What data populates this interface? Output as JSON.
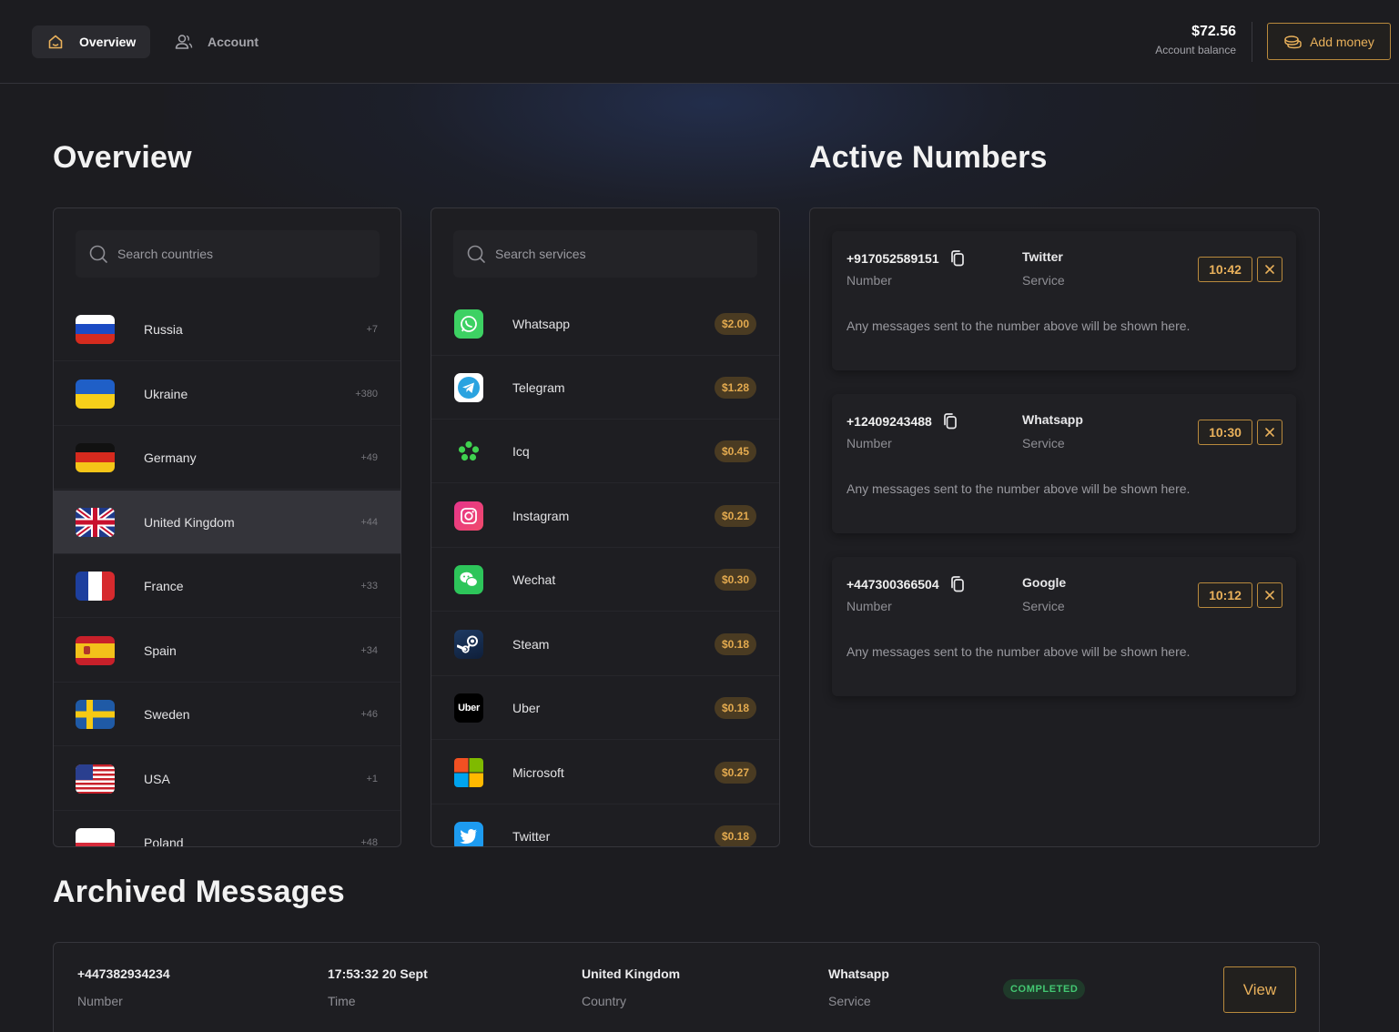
{
  "nav": {
    "tabs": [
      {
        "label": "Overview",
        "icon": "home-icon",
        "active": true
      },
      {
        "label": "Account",
        "icon": "users-icon",
        "active": false
      }
    ],
    "balance": {
      "amount": "$72.56",
      "label": "Account balance"
    },
    "add_money_label": "Add money"
  },
  "overview": {
    "title": "Overview",
    "countries": {
      "search_placeholder": "Search countries",
      "items": [
        {
          "name": "Russia",
          "code": "+7"
        },
        {
          "name": "Ukraine",
          "code": "+380"
        },
        {
          "name": "Germany",
          "code": "+49"
        },
        {
          "name": "United Kingdom",
          "code": "+44",
          "selected": true
        },
        {
          "name": "France",
          "code": "+33"
        },
        {
          "name": "Spain",
          "code": "+34"
        },
        {
          "name": "Sweden",
          "code": "+46"
        },
        {
          "name": "USA",
          "code": "+1"
        },
        {
          "name": "Poland",
          "code": "+48"
        }
      ]
    },
    "services": {
      "search_placeholder": "Search services",
      "items": [
        {
          "name": "Whatsapp",
          "price": "$2.00",
          "icon": "whatsapp-icon"
        },
        {
          "name": "Telegram",
          "price": "$1.28",
          "icon": "telegram-icon"
        },
        {
          "name": "Icq",
          "price": "$0.45",
          "icon": "icq-icon"
        },
        {
          "name": "Instagram",
          "price": "$0.21",
          "icon": "instagram-icon"
        },
        {
          "name": "Wechat",
          "price": "$0.30",
          "icon": "wechat-icon"
        },
        {
          "name": "Steam",
          "price": "$0.18",
          "icon": "steam-icon"
        },
        {
          "name": "Uber",
          "price": "$0.18",
          "icon": "uber-icon",
          "icon_text": "Uber"
        },
        {
          "name": "Microsoft",
          "price": "$0.27",
          "icon": "microsoft-icon"
        },
        {
          "name": "Twitter",
          "price": "$0.18",
          "icon": "twitter-icon"
        }
      ]
    }
  },
  "active_numbers": {
    "title": "Active Numbers",
    "number_label": "Number",
    "service_label": "Service",
    "message": "Any messages sent to the number above will be shown here.",
    "items": [
      {
        "number": "+917052589151",
        "service": "Twitter",
        "timer": "10:42"
      },
      {
        "number": "+12409243488",
        "service": "Whatsapp",
        "timer": "10:30"
      },
      {
        "number": "+447300366504",
        "service": "Google",
        "timer": "10:12"
      }
    ]
  },
  "archived": {
    "title": "Archived Messages",
    "items": [
      {
        "number": "+447382934234",
        "number_label": "Number",
        "time": "17:53:32 20 Sept",
        "time_label": "Time",
        "country": "United Kingdom",
        "country_label": "Country",
        "service": "Whatsapp",
        "service_label": "Service",
        "status": "COMPLETED",
        "view_label": "View"
      }
    ]
  },
  "colors": {
    "accent": "#e9b15b",
    "success": "#43c772",
    "background": "#1c1c20"
  }
}
